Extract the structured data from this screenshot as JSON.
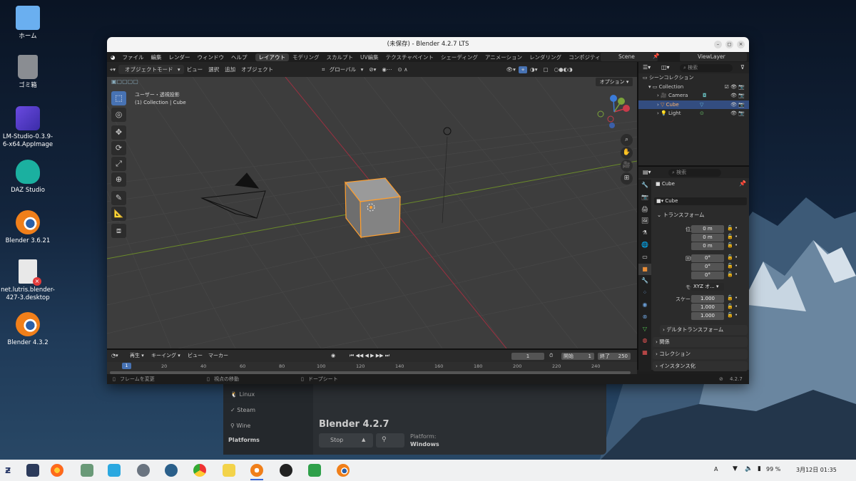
{
  "desktop": {
    "icons": [
      {
        "label": "ホーム"
      },
      {
        "label": "ゴミ箱"
      },
      {
        "label": "LM-Studio-0.3.9-6-x64.AppImage"
      },
      {
        "label": "DAZ Studio"
      },
      {
        "label": "Blender 3.6.21"
      },
      {
        "label": "net.lutris.blender-427-3.desktop"
      },
      {
        "label": "Blender 4.3.2"
      }
    ]
  },
  "lutris": {
    "side_items": [
      "Linux",
      "Steam",
      "Wine"
    ],
    "platforms_heading": "Platforms",
    "game_title": "Blender 4.2.7",
    "stop_label": "Stop",
    "platform_label": "Platform:",
    "platform_value": "Windows"
  },
  "blender": {
    "title": "(未保存) - Blender 4.2.7 LTS",
    "menus": [
      "ファイル",
      "編集",
      "レンダー",
      "ウィンドウ",
      "ヘルプ"
    ],
    "workspaces": [
      "レイアウト",
      "モデリング",
      "スカルプト",
      "UV編集",
      "テクスチャペイント",
      "シェーディング",
      "アニメーション",
      "レンダリング",
      "コンポジティング"
    ],
    "scene": "Scene",
    "view_layer": "ViewLayer",
    "header": {
      "mode": "オブジェクトモード",
      "menus": [
        "ビュー",
        "選択",
        "追加",
        "オブジェクト"
      ],
      "orientation": "グローバル",
      "options": "オプション"
    },
    "viewport": {
      "view_name": "ユーザー・透視投影",
      "context": "(1) Collection | Cube"
    },
    "outliner": {
      "search_placeholder": "検索",
      "scene_collection": "シーンコレクション",
      "collection": "Collection",
      "objects": [
        "Camera",
        "Cube",
        "Light"
      ]
    },
    "properties": {
      "search_placeholder": "検索",
      "object_name": "Cube",
      "data_name": "Cube",
      "transform": "トランスフォーム",
      "location_label": "位置 X",
      "location": [
        "0 m",
        "0 m",
        "0 m"
      ],
      "rotation_label": "回転 X",
      "rotation": [
        "0°",
        "0°",
        "0°"
      ],
      "mode_label": "モード",
      "mode_value": "XYZ オ...",
      "scale_label": "スケール X",
      "scale": [
        "1.000",
        "1.000",
        "1.000"
      ],
      "axis_y": "Y",
      "axis_z": "Z",
      "delta": "デルタトランスフォーム",
      "relations": "関係",
      "collections": "コレクション",
      "instancing": "インスタンス化"
    },
    "timeline": {
      "menus": [
        "再生",
        "キーイング",
        "ビュー",
        "マーカー"
      ],
      "current_frame": "1",
      "start_label": "開始",
      "start": "1",
      "end_label": "終了",
      "end": "250",
      "ticks": [
        "1",
        "20",
        "40",
        "60",
        "80",
        "100",
        "120",
        "140",
        "160",
        "180",
        "200",
        "220",
        "240"
      ]
    },
    "status": {
      "left": "フレームを変更",
      "mid": "視点の移動",
      "right": "ドープシート",
      "version": "4.2.7"
    }
  },
  "taskbar": {
    "keyboard": "A",
    "battery": "99 %",
    "datetime": "3月12日 01:35"
  },
  "colors": {
    "accent": "#4772b3",
    "selection": "#ff9f2e",
    "x_axis": "#c83b4b",
    "y_axis": "#7ba33a"
  }
}
